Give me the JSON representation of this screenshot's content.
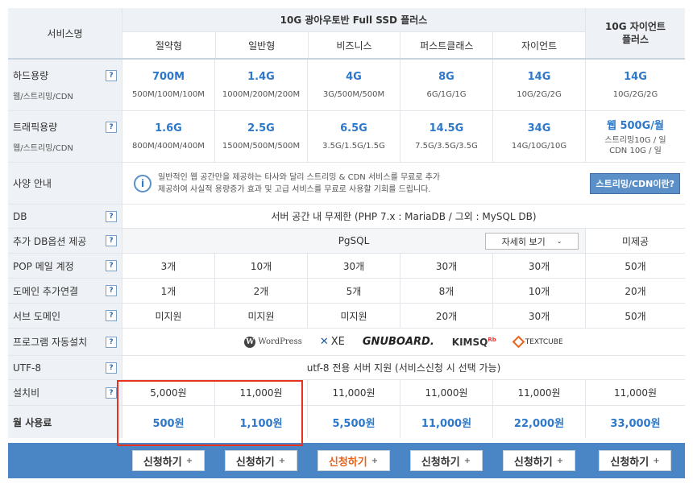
{
  "header": {
    "service_name": "서비스명",
    "group_title": "10G 광아우토반 Full SSD 플러스",
    "plans": [
      "절약형",
      "일반형",
      "비즈니스",
      "퍼스트클래스",
      "자이언트"
    ],
    "giant_plus": "10G 자이언트 플러스"
  },
  "rows": {
    "disk": {
      "label": "하드용량",
      "sub": "웹/스트리밍/CDN",
      "main": [
        "700M",
        "1.4G",
        "4G",
        "8G",
        "14G",
        "14G"
      ],
      "detail": [
        "500M/100M/100M",
        "1000M/200M/200M",
        "3G/500M/500M",
        "6G/1G/1G",
        "10G/2G/2G",
        "10G/2G/2G"
      ]
    },
    "traffic": {
      "label": "트래픽용량",
      "sub": "웹/스트리밍/CDN",
      "main": [
        "1.6G",
        "2.5G",
        "6.5G",
        "14.5G",
        "34G",
        "웹 500G/월"
      ],
      "detail": [
        "800M/400M/400M",
        "1500M/500M/500M",
        "3.5G/1.5G/1.5G",
        "7.5G/3.5G/3.5G",
        "14G/10G/10G",
        "스트리밍10G / 일"
      ],
      "detail2": [
        "",
        "",
        "",
        "",
        "",
        "CDN 10G / 일"
      ]
    },
    "spec": {
      "label": "사양 안내",
      "text1": "일반적인 웹 공간만을 제공하는 타사와 달리 스트리밍 & CDN 서비스를 무료로 추가",
      "text2": "제공하여 사실적 용량증가 효과 및 고급 서비스를 무료로 사용할 기회를 드립니다.",
      "button": "스트리밍/CDN이란?"
    },
    "db": {
      "label": "DB",
      "value": "서버 공간 내 무제한 (PHP 7.x : MariaDB / 그외 : MySQL DB)"
    },
    "dbopt": {
      "label": "추가 DB옵션 제공",
      "value": "PgSQL",
      "select": "자세히 보기",
      "giant": "미제공"
    },
    "pop": {
      "label": "POP 메일 계정",
      "values": [
        "3개",
        "10개",
        "30개",
        "30개",
        "30개",
        "50개"
      ]
    },
    "domain": {
      "label": "도메인 추가연결",
      "values": [
        "1개",
        "2개",
        "5개",
        "8개",
        "10개",
        "20개"
      ]
    },
    "sub": {
      "label": "서브 도메인",
      "values": [
        "미지원",
        "미지원",
        "미지원",
        "20개",
        "30개",
        "50개"
      ]
    },
    "auto": {
      "label": "프로그램 자동설치",
      "logos": [
        "WordPress",
        "XE",
        "GNUBOARD.",
        "KIMSQ",
        "TEXTCUBE"
      ]
    },
    "utf": {
      "label": "UTF-8",
      "value": "utf-8 전용 서버 지원 (서비스신청 시 선택 가능)"
    },
    "setup": {
      "label": "설치비",
      "values": [
        "5,000원",
        "11,000원",
        "11,000원",
        "11,000원",
        "11,000원",
        "11,000원"
      ]
    },
    "monthly": {
      "label": "월 사용료",
      "values": [
        "500원",
        "1,100원",
        "5,500원",
        "11,000원",
        "22,000원",
        "33,000원"
      ]
    }
  },
  "footer": {
    "button_label": "신청하기"
  },
  "colors": {
    "accent_blue": "#2d78c8",
    "footer_bg": "#4a86c5",
    "highlight_red": "#e8321e",
    "orange": "#e8621a"
  }
}
